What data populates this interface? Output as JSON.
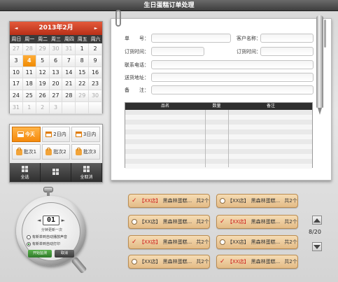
{
  "app": {
    "title": "生日蛋糕订单处理"
  },
  "calendar": {
    "month_label": "2013年2月",
    "prev": "◄",
    "next": "►",
    "weekdays": [
      "周日",
      "周一",
      "周二",
      "周三",
      "周四",
      "周五",
      "周六"
    ],
    "days": [
      {
        "d": "28",
        "m": false
      },
      {
        "d": "29",
        "m": false
      },
      {
        "d": "30",
        "m": false
      },
      {
        "d": "31",
        "m": false
      },
      {
        "d": "1",
        "m": false
      },
      {
        "d": "2",
        "m": false
      },
      {
        "d": "3",
        "m": false
      },
      {
        "d": "4",
        "m": false
      },
      {
        "d": "5",
        "m": false
      },
      {
        "d": "6",
        "m": false
      },
      {
        "d": "7",
        "m": false
      },
      {
        "d": "8",
        "m": false
      },
      {
        "d": "9",
        "m": false
      },
      {
        "d": "10",
        "m": false
      },
      {
        "d": "11",
        "m": false
      },
      {
        "d": "12",
        "m": false
      },
      {
        "d": "13",
        "m": false
      },
      {
        "d": "14",
        "m": false
      },
      {
        "d": "15",
        "m": false
      },
      {
        "d": "16",
        "m": false
      },
      {
        "d": "17",
        "m": false
      },
      {
        "d": "18",
        "m": false
      },
      {
        "d": "19",
        "m": false
      },
      {
        "d": "20",
        "m": false
      },
      {
        "d": "21",
        "m": false
      },
      {
        "d": "22",
        "m": false
      },
      {
        "d": "23",
        "m": false
      },
      {
        "d": "24",
        "m": false
      },
      {
        "d": "25",
        "m": false
      },
      {
        "d": "26",
        "m": false
      },
      {
        "d": "27",
        "m": false
      },
      {
        "d": "28",
        "m": false
      },
      {
        "d": "29",
        "m": false
      },
      {
        "d": "30",
        "m": false
      },
      {
        "d": "31",
        "m": false
      },
      {
        "d": "1",
        "m": false
      },
      {
        "d": "2",
        "m": false
      },
      {
        "d": "3",
        "m": false
      },
      {
        "d": "4",
        "m": false
      },
      {
        "d": "5",
        "m": false
      },
      {
        "d": "6",
        "m": false
      },
      {
        "d": "7",
        "m": false
      }
    ],
    "grid_days": [
      "27",
      "28",
      "29",
      "30",
      "31",
      "1",
      "2",
      "3",
      "4",
      "5",
      "6",
      "7",
      "8",
      "9",
      "10",
      "11",
      "12",
      "13",
      "14",
      "15",
      "16",
      "17",
      "18",
      "19",
      "20",
      "21",
      "22",
      "23",
      "24",
      "25",
      "26",
      "27",
      "28",
      "29",
      "30",
      "31",
      "1",
      "2",
      "3"
    ],
    "today": "4"
  },
  "quick": {
    "row1": [
      "今天",
      "2日内",
      "3日内"
    ],
    "row2": [
      "批次1",
      "批次2",
      "批次3"
    ],
    "bottom": [
      "全选",
      "",
      "全取消"
    ]
  },
  "form": {
    "order_no_label": "单　　号：",
    "customer_label": "客户名称：",
    "order_time_label": "订货时间：",
    "order_time2_label": "订货时间：",
    "phone_label": "联系电话：",
    "address_label": "送货地址：",
    "note_label": "备　　注："
  },
  "table": {
    "headers": [
      "品名",
      "数量",
      "备注"
    ]
  },
  "orders": [
    {
      "store": "【XX店】",
      "name": "黑森林蛋糕...",
      "count": "共2个",
      "checked": true
    },
    {
      "store": "【XX店】",
      "name": "黑森林蛋糕...",
      "count": "共2个",
      "checked": false
    },
    {
      "store": "【XX店】",
      "name": "黑森林蛋糕...",
      "count": "共2个",
      "checked": false
    },
    {
      "store": "【XX店】",
      "name": "黑森林蛋糕...",
      "count": "共2个",
      "checked": true
    },
    {
      "store": "【XX店】",
      "name": "黑森林蛋糕...",
      "count": "共2个",
      "checked": true
    },
    {
      "store": "【XX店】",
      "name": "黑森林蛋糕...",
      "count": "共2个",
      "checked": false
    },
    {
      "store": "【XX店】",
      "name": "黑森林蛋糕...",
      "count": "共2个",
      "checked": false
    },
    {
      "store": "【XX店】",
      "name": "黑森林蛋糕...",
      "count": "共2个",
      "checked": true
    }
  ],
  "pager": {
    "label": "8/20"
  },
  "watch": {
    "minutes": "01",
    "refresh_label": "分钟更新一次",
    "opt1": "有新单到自动播放声音",
    "opt2": "有新单到自动打印",
    "start": "开始监测",
    "cancel": "取消"
  }
}
